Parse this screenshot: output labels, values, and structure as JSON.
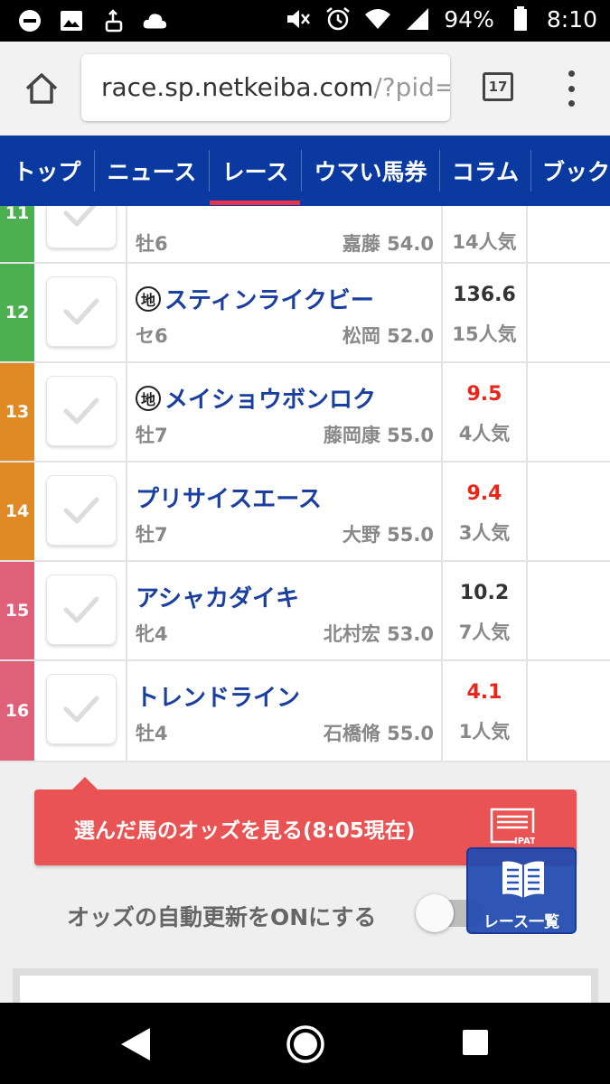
{
  "status_bar": {
    "battery": "94%",
    "time": "8:10",
    "icons": [
      "notification-block-icon",
      "image-icon",
      "usb-icon",
      "cloud-icon",
      "mute-icon",
      "alarm-icon",
      "wifi-icon",
      "signal-icon",
      "battery-icon"
    ]
  },
  "browser": {
    "url_host": "race.sp.netkeiba.com",
    "url_path": "/?pid=",
    "tab_count": "17"
  },
  "nav": {
    "items": [
      "トップ",
      "ニュース",
      "レース",
      "ウマい馬券",
      "コラム",
      "ブック"
    ],
    "active_index": 2,
    "bg_color": "#0a3aa0",
    "active_color": "#e8344b"
  },
  "horses": [
    {
      "no": "11",
      "frame_color": "#4caf50",
      "name": "",
      "local": false,
      "sex_age": "牡6",
      "jockey_weight": "嘉藤 54.0",
      "odds": "",
      "odds_hot": false,
      "popularity": "14人気"
    },
    {
      "no": "12",
      "frame_color": "#4caf50",
      "name": "スティンライクビー",
      "local": true,
      "sex_age": "セ6",
      "jockey_weight": "松岡 52.0",
      "odds": "136.6",
      "odds_hot": false,
      "popularity": "15人気"
    },
    {
      "no": "13",
      "frame_color": "#e08a26",
      "name": "メイショウボンロク",
      "local": true,
      "sex_age": "牡7",
      "jockey_weight": "藤岡康 55.0",
      "odds": "9.5",
      "odds_hot": true,
      "popularity": "4人気"
    },
    {
      "no": "14",
      "frame_color": "#e08a26",
      "name": "プリサイスエース",
      "local": false,
      "sex_age": "牡7",
      "jockey_weight": "大野 55.0",
      "odds": "9.4",
      "odds_hot": true,
      "popularity": "3人気"
    },
    {
      "no": "15",
      "frame_color": "#e0607a",
      "name": "アシャカダイキ",
      "local": false,
      "sex_age": "牝4",
      "jockey_weight": "北村宏 53.0",
      "odds": "10.2",
      "odds_hot": false,
      "popularity": "7人気"
    },
    {
      "no": "16",
      "frame_color": "#e0607a",
      "name": "トレンドライン",
      "local": false,
      "sex_age": "牡4",
      "jockey_weight": "石橋脩 55.0",
      "odds": "4.1",
      "odds_hot": true,
      "popularity": "1人気"
    }
  ],
  "local_badge": "地",
  "odds_button": {
    "label": "選んだ馬のオッズを見る(8:05現在)",
    "ipat_label": "IPAT"
  },
  "auto_update": {
    "label": "オッズの自動更新をONにする",
    "on": false
  },
  "race_list_button": {
    "label": "レース一覧"
  },
  "colors": {
    "hot_odds": "#e8261a",
    "odds_button": "#ea5353"
  }
}
